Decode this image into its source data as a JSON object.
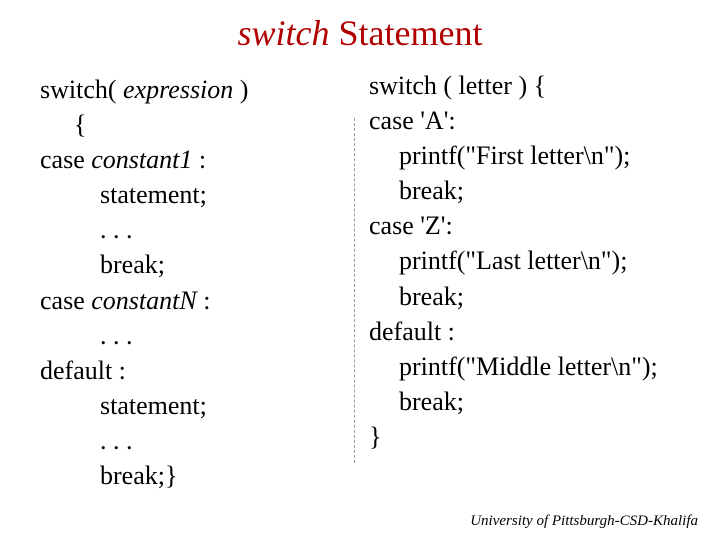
{
  "title": {
    "italic_word": "switch",
    "plain_word": " Statement"
  },
  "syntax": {
    "l1a": "switch( ",
    "l1b": "expression",
    "l1c": " )",
    "l2": "{",
    "l3a": "case ",
    "l3b": "constant1",
    "l3c": " :",
    "l4": "statement;",
    "l5": ". . .",
    "l6": "break;",
    "l7a": "case ",
    "l7b": "constantN",
    "l7c": " :",
    "l8": ". . .",
    "l9": "default :",
    "l10": "statement;",
    "l11": ". . .",
    "l12": "break;}"
  },
  "example": {
    "l1": "switch ( letter ) {",
    "l2": "case 'A':",
    "l3": "printf(\"First letter\\n\");",
    "l4": "break;",
    "l5": "case 'Z':",
    "l6": "printf(\"Last letter\\n\");",
    "l7": "break;",
    "l8": "default :",
    "l9": "printf(\"Middle letter\\n\");",
    "l10": "break;",
    "l11": "}"
  },
  "footer": "University of Pittsburgh-CSD-Khalifa"
}
